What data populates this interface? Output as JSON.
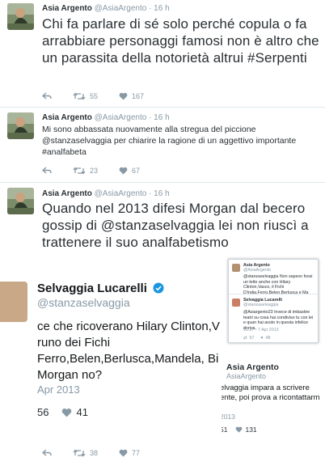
{
  "tweets": [
    {
      "name": "Asia Argento",
      "handle": "@AsiaArgento",
      "time": "· 16 h",
      "text": "Chi fa parlare di sé solo perché  copula o fa arrabbiare personaggi famosi non è altro che un parassita della notorietà altrui #Serpenti",
      "retweets": "55",
      "likes": "167"
    },
    {
      "name": "Asia Argento",
      "handle": "@AsiaArgento",
      "time": "· 16 h",
      "text": "Mi sono abbassata nuovamente alla stregua del piccione @stanzaselvaggia per chiarire la ragione di un aggettivo importante #analfabeta",
      "retweets": "23",
      "likes": "67"
    },
    {
      "name": "Asia Argento",
      "handle": "@AsiaArgento",
      "time": "· 16 h",
      "text_before": "Quando nel 2013 difesi Morgan dal becero gossip di ",
      "mention": "@stanzaselvaggia",
      "text_after": " lei non riuscì a trattenere il suo analfabetismo",
      "retweets": "38",
      "likes": "77"
    }
  ],
  "embed": {
    "name": "Selvaggia Lucarelli",
    "handle": "@stanzaselvaggia",
    "lines": [
      "ce che ricoverano Hilary Clinton,V",
      "runo dei Fichi",
      "Ferro,Belen,Berlusca,Mandela, Bi",
      "Morgan no?"
    ],
    "date": "Apr 2013",
    "retweets": "56",
    "likes": "41"
  },
  "overlay": {
    "tweet1_name": "Asia Argento",
    "tweet1_handle": "@AsiaArgento",
    "tweet1_text": "@stanzaselvaggia  Non sapevo fossi un letto anche con Hilary Clinton,Vasco, il Fichi D'india,Ferro,Belen,Berlusca e Ma",
    "tweet2_name": "Selvaggia Lucarelli",
    "tweet2_handle": "@stanzaselvaggia",
    "tweet2_text": "@Asiargento23 Invece di imbastire teatri su cosa hai condiviso tu con lei e quan hai avuto in questa infelice deriva.",
    "tweet2_time": "15:27 - 7 Apr 2013",
    "tweet2_rt": "57",
    "tweet2_likes": "48"
  },
  "quoted": {
    "name": "Asia Argento",
    "handle": "AsiaArgento",
    "lines": [
      "elvaggia impara a scrivere",
      "ente, poi prova a ricontattarm"
    ],
    "date": "2013",
    "retweets": "51",
    "likes": "131"
  },
  "colors": {
    "accent": "#1b95e0",
    "muted": "#8899a6",
    "text": "#292f33"
  }
}
